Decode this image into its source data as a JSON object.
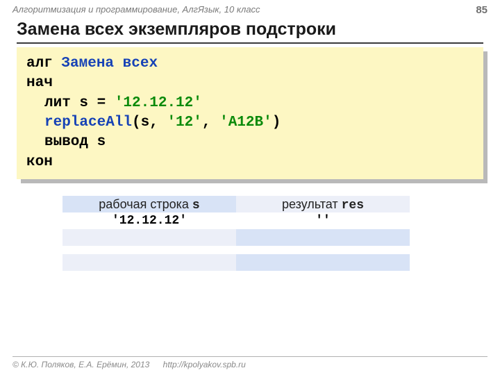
{
  "header": {
    "course": "Алгоритмизация и программирование, АлгЯзык, 10 класс",
    "page": "85"
  },
  "title": "Замена всех экземпляров подстроки",
  "code": {
    "l1_kw": "алг",
    "l1_name": "Замена всех",
    "l2": "нач",
    "l3_pre": "лит s = ",
    "l3_lit": "'12.12.12'",
    "l4_call": "replaceAll",
    "l4_open": "(s, ",
    "l4_arg2": "'12'",
    "l4_comma": ", ",
    "l4_arg3": "'A12B'",
    "l4_close": ")",
    "l5": "вывод s",
    "l6": "кон"
  },
  "table": {
    "h1_a": "рабочая строка ",
    "h1_b": "s",
    "h2_a": "результат ",
    "h2_b": "res",
    "r2c1": "'12.12.12'",
    "r2c2": "''"
  },
  "footer": {
    "copyright": "© К.Ю. Поляков, Е.А. Ерёмин, 2013",
    "url": "http://kpolyakov.spb.ru"
  }
}
